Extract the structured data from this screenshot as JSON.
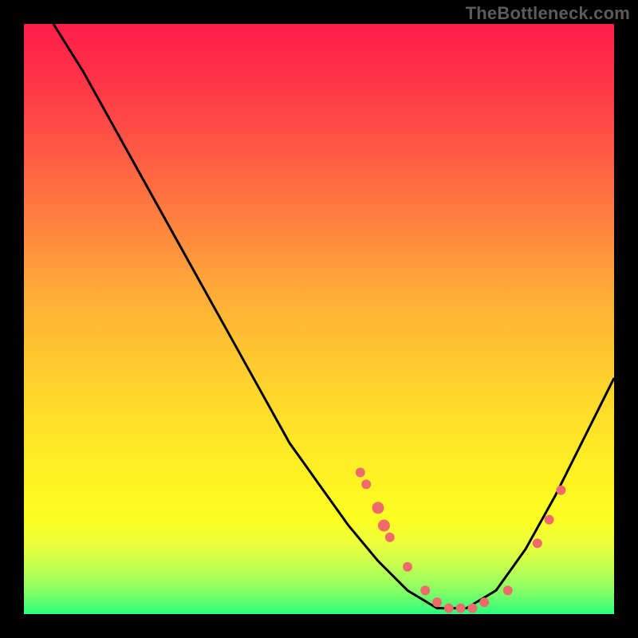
{
  "watermark": "TheBottleneck.com",
  "chart_data": {
    "type": "line",
    "title": "",
    "xlabel": "",
    "ylabel": "",
    "x_range": [
      0,
      100
    ],
    "y_range": [
      0,
      100
    ],
    "curve": [
      {
        "x": 5,
        "y": 100
      },
      {
        "x": 10,
        "y": 92
      },
      {
        "x": 15,
        "y": 83
      },
      {
        "x": 20,
        "y": 74
      },
      {
        "x": 25,
        "y": 65
      },
      {
        "x": 30,
        "y": 56
      },
      {
        "x": 35,
        "y": 47
      },
      {
        "x": 40,
        "y": 38
      },
      {
        "x": 45,
        "y": 29
      },
      {
        "x": 50,
        "y": 22
      },
      {
        "x": 55,
        "y": 15
      },
      {
        "x": 60,
        "y": 9
      },
      {
        "x": 65,
        "y": 4
      },
      {
        "x": 70,
        "y": 1
      },
      {
        "x": 75,
        "y": 1
      },
      {
        "x": 80,
        "y": 4
      },
      {
        "x": 85,
        "y": 11
      },
      {
        "x": 90,
        "y": 20
      },
      {
        "x": 95,
        "y": 30
      },
      {
        "x": 100,
        "y": 40
      }
    ],
    "bottleneck_markers": [
      {
        "x": 57,
        "y": 24,
        "r": 6
      },
      {
        "x": 58,
        "y": 22,
        "r": 6
      },
      {
        "x": 60,
        "y": 18,
        "r": 7.5
      },
      {
        "x": 61,
        "y": 15,
        "r": 7.5
      },
      {
        "x": 62,
        "y": 13,
        "r": 6
      },
      {
        "x": 65,
        "y": 8,
        "r": 6
      },
      {
        "x": 68,
        "y": 4,
        "r": 6
      },
      {
        "x": 70,
        "y": 2,
        "r": 6
      },
      {
        "x": 72,
        "y": 1,
        "r": 6
      },
      {
        "x": 74,
        "y": 1,
        "r": 6
      },
      {
        "x": 76,
        "y": 1,
        "r": 6
      },
      {
        "x": 78,
        "y": 2,
        "r": 6
      },
      {
        "x": 82,
        "y": 4,
        "r": 6
      },
      {
        "x": 87,
        "y": 12,
        "r": 6
      },
      {
        "x": 89,
        "y": 16,
        "r": 6
      },
      {
        "x": 91,
        "y": 21,
        "r": 6
      }
    ],
    "marker_color": "#ed6b6b",
    "curve_color": "#000000"
  }
}
